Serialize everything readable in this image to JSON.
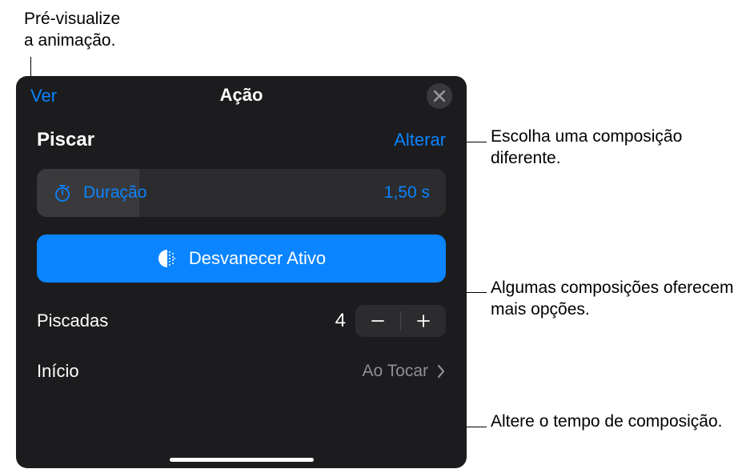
{
  "callouts": {
    "preview": "Pré-visualize\na animação.",
    "choose": "Escolha uma composição diferente.",
    "options": "Algumas composições oferecem mais opções.",
    "timing": "Altere o tempo de composição."
  },
  "panel": {
    "header": {
      "preview_label": "Ver",
      "title": "Ação"
    },
    "effect": {
      "name": "Piscar",
      "change_label": "Alterar"
    },
    "duration": {
      "label": "Duração",
      "value": "1,50 s"
    },
    "fade": {
      "label": "Desvanecer Ativo"
    },
    "blinks": {
      "label": "Piscadas",
      "value": "4"
    },
    "start": {
      "label": "Início",
      "value": "Ao Tocar"
    }
  },
  "colors": {
    "accent": "#0a84ff",
    "panel_bg": "#1c1c1e",
    "cell_bg": "#2c2c2e",
    "secondary_text": "#8e8e93"
  }
}
